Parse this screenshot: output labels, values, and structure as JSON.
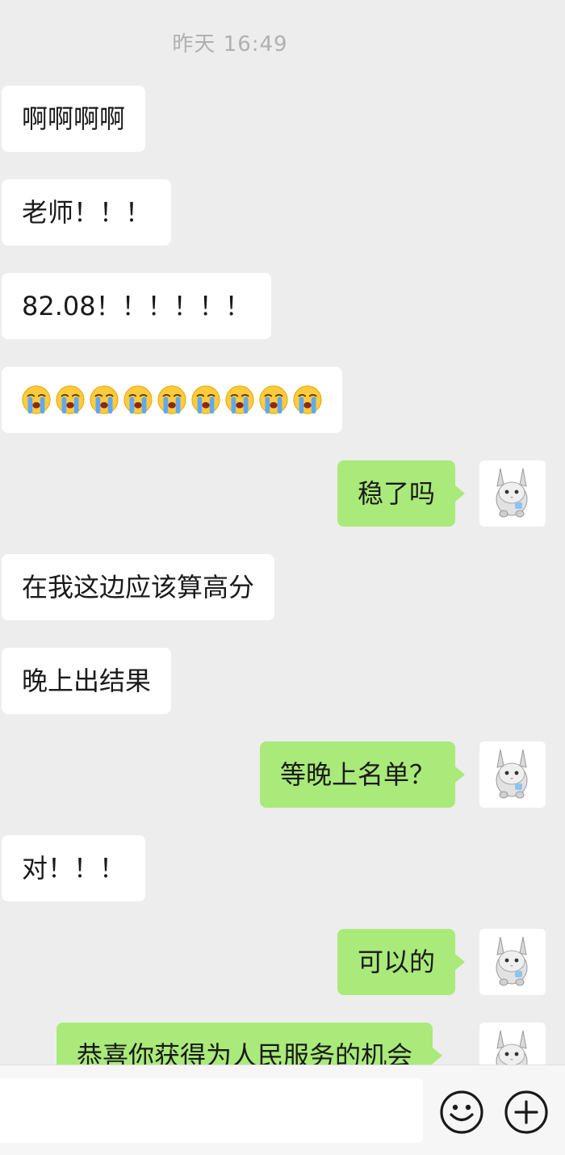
{
  "timestamp": "昨天 16:49",
  "messages": [
    {
      "side": "in",
      "text": "啊啊啊啊"
    },
    {
      "side": "in",
      "text": "老师！！！"
    },
    {
      "side": "in",
      "text": "82.08！！！！！！"
    },
    {
      "side": "in",
      "emoji": "loudly-crying-face",
      "emoji_count": 9
    },
    {
      "side": "out",
      "text": "稳了吗"
    },
    {
      "side": "in",
      "text": "在我这边应该算高分"
    },
    {
      "side": "in",
      "text": "晚上出结果"
    },
    {
      "side": "out",
      "text": "等晚上名单？"
    },
    {
      "side": "in",
      "text": "对！！！"
    },
    {
      "side": "out",
      "text": "可以的"
    },
    {
      "side": "out",
      "text": "恭喜你获得为人民服务的机会"
    }
  ],
  "input": {
    "value": "",
    "emoji_icon": "smiley-face-icon",
    "plus_icon": "plus-circle-icon"
  },
  "colors": {
    "background": "#ededed",
    "incoming_bubble": "#ffffff",
    "outgoing_bubble": "#a9ea7a",
    "timestamp_text": "#b0b0b0"
  }
}
